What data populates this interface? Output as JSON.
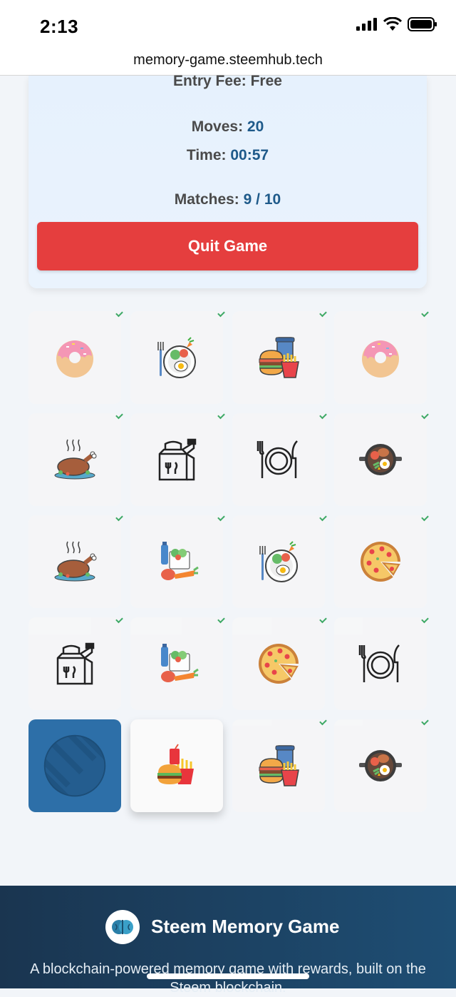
{
  "status_bar": {
    "time": "2:13"
  },
  "browser": {
    "url": "memory-game.steemhub.tech"
  },
  "game_info": {
    "entry_fee_label": "Entry Fee:",
    "entry_fee_value": "Free",
    "moves_label": "Moves:",
    "moves_value": "20",
    "time_label": "Time:",
    "time_value": "00:57",
    "matches_label": "Matches:",
    "matches_value": "9 / 10",
    "quit_label": "Quit Game"
  },
  "board": {
    "cards": [
      {
        "icon": "donut-icon",
        "state": "matched"
      },
      {
        "icon": "salad-plate-icon",
        "state": "matched"
      },
      {
        "icon": "fast-food-combo-icon",
        "state": "matched"
      },
      {
        "icon": "donut-icon",
        "state": "matched"
      },
      {
        "icon": "roast-chicken-icon",
        "state": "matched"
      },
      {
        "icon": "takeout-bag-icon",
        "state": "matched"
      },
      {
        "icon": "plate-cutlery-icon",
        "state": "matched"
      },
      {
        "icon": "pan-meal-icon",
        "state": "matched"
      },
      {
        "icon": "roast-chicken-icon",
        "state": "matched"
      },
      {
        "icon": "groceries-icon",
        "state": "matched"
      },
      {
        "icon": "salad-plate-icon",
        "state": "matched"
      },
      {
        "icon": "pizza-icon",
        "state": "matched"
      },
      {
        "icon": "takeout-bag-icon",
        "state": "matched"
      },
      {
        "icon": "groceries-icon",
        "state": "matched"
      },
      {
        "icon": "pizza-icon",
        "state": "matched"
      },
      {
        "icon": "plate-cutlery-icon",
        "state": "matched"
      },
      {
        "icon": "card-back-icon",
        "state": "hidden"
      },
      {
        "icon": "burger-fries-icon",
        "state": "flipped"
      },
      {
        "icon": "fast-food-combo-icon",
        "state": "matched"
      },
      {
        "icon": "pan-meal-icon",
        "state": "matched"
      }
    ]
  },
  "footer": {
    "title": "Steem Memory Game",
    "description": "A blockchain-powered memory game with rewards, built on the Steem blockchain."
  },
  "colors": {
    "accent": "#1e5a8a",
    "danger": "#e53e3e",
    "card_back": "#2d6fa8"
  }
}
